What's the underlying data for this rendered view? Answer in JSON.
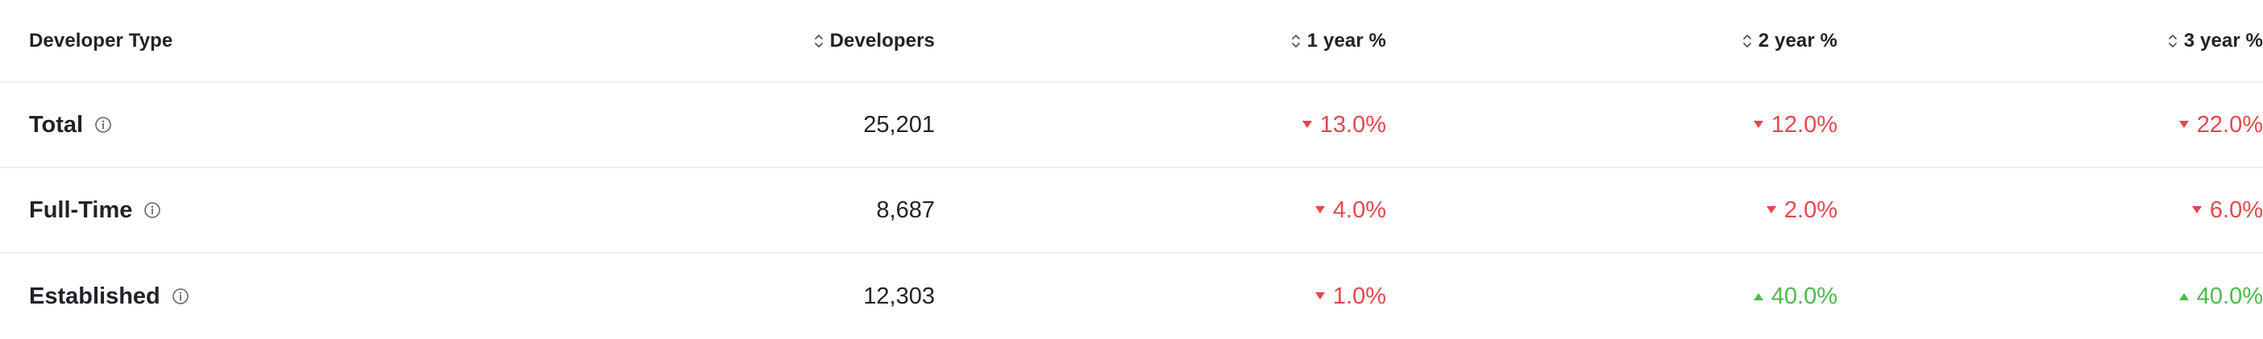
{
  "table": {
    "columns": {
      "type": "Developer Type",
      "developers": "Developers",
      "y1": "1 year %",
      "y2": "2 year %",
      "y3": "3 year %"
    },
    "rows": [
      {
        "name": "Total",
        "developers": "25,201",
        "y1": {
          "value": "13.0%",
          "dir": "down"
        },
        "y2": {
          "value": "12.0%",
          "dir": "down"
        },
        "y3": {
          "value": "22.0%",
          "dir": "down"
        }
      },
      {
        "name": "Full-Time",
        "developers": "8,687",
        "y1": {
          "value": "4.0%",
          "dir": "down"
        },
        "y2": {
          "value": "2.0%",
          "dir": "down"
        },
        "y3": {
          "value": "6.0%",
          "dir": "down"
        }
      },
      {
        "name": "Established",
        "developers": "12,303",
        "y1": {
          "value": "1.0%",
          "dir": "down"
        },
        "y2": {
          "value": "40.0%",
          "dir": "up"
        },
        "y3": {
          "value": "40.0%",
          "dir": "up"
        }
      }
    ]
  },
  "colors": {
    "down": "#e5484d",
    "up": "#4cbb4a",
    "text": "#1f2328",
    "divider": "#eeeeee"
  },
  "icons": {
    "sort": "sort-updown-icon",
    "info": "info-icon",
    "down": "triangle-down-icon",
    "up": "triangle-up-icon"
  }
}
